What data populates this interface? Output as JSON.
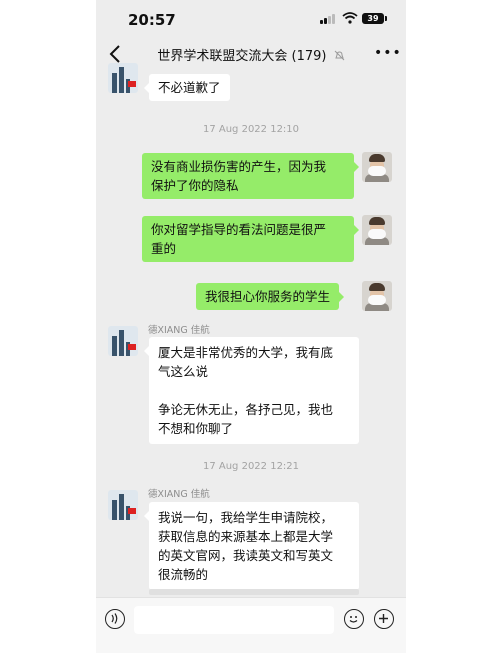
{
  "status": {
    "time": "20:57",
    "battery": "39"
  },
  "nav": {
    "title": "世界学术联盟交流大会 (179)",
    "more": "•••"
  },
  "messages": [
    {
      "side": "left",
      "text": "不必道歉了"
    },
    {
      "side": "time",
      "text": "17 Aug 2022 12:10"
    },
    {
      "side": "right",
      "lines": [
        "没有商业损伤害的产生，因为我",
        "保护了你的隐私"
      ]
    },
    {
      "side": "right",
      "lines": [
        "你对留学指导的看法问题是很严",
        "重的"
      ]
    },
    {
      "side": "right",
      "text": "我很担心你服务的学生"
    },
    {
      "side": "left",
      "sender": "德XIANG  佳航",
      "lines": [
        "厦大是非常优秀的大学，我有底",
        "气这么说",
        "",
        "争论无休无止，各抒己见，我也",
        "不想和你聊了"
      ]
    },
    {
      "side": "time",
      "text": "17 Aug 2022 12:21"
    },
    {
      "side": "left",
      "sender": "德XIANG  佳航",
      "lines": [
        "我说一句，我给学生申请院校，",
        "获取信息的来源基本上都是大学",
        "的英文官网，我读英文和写英文",
        "很流畅的"
      ]
    }
  ],
  "icons": {
    "voice": "voice-icon",
    "emoji": "emoji-icon",
    "plus": "plus-icon"
  }
}
